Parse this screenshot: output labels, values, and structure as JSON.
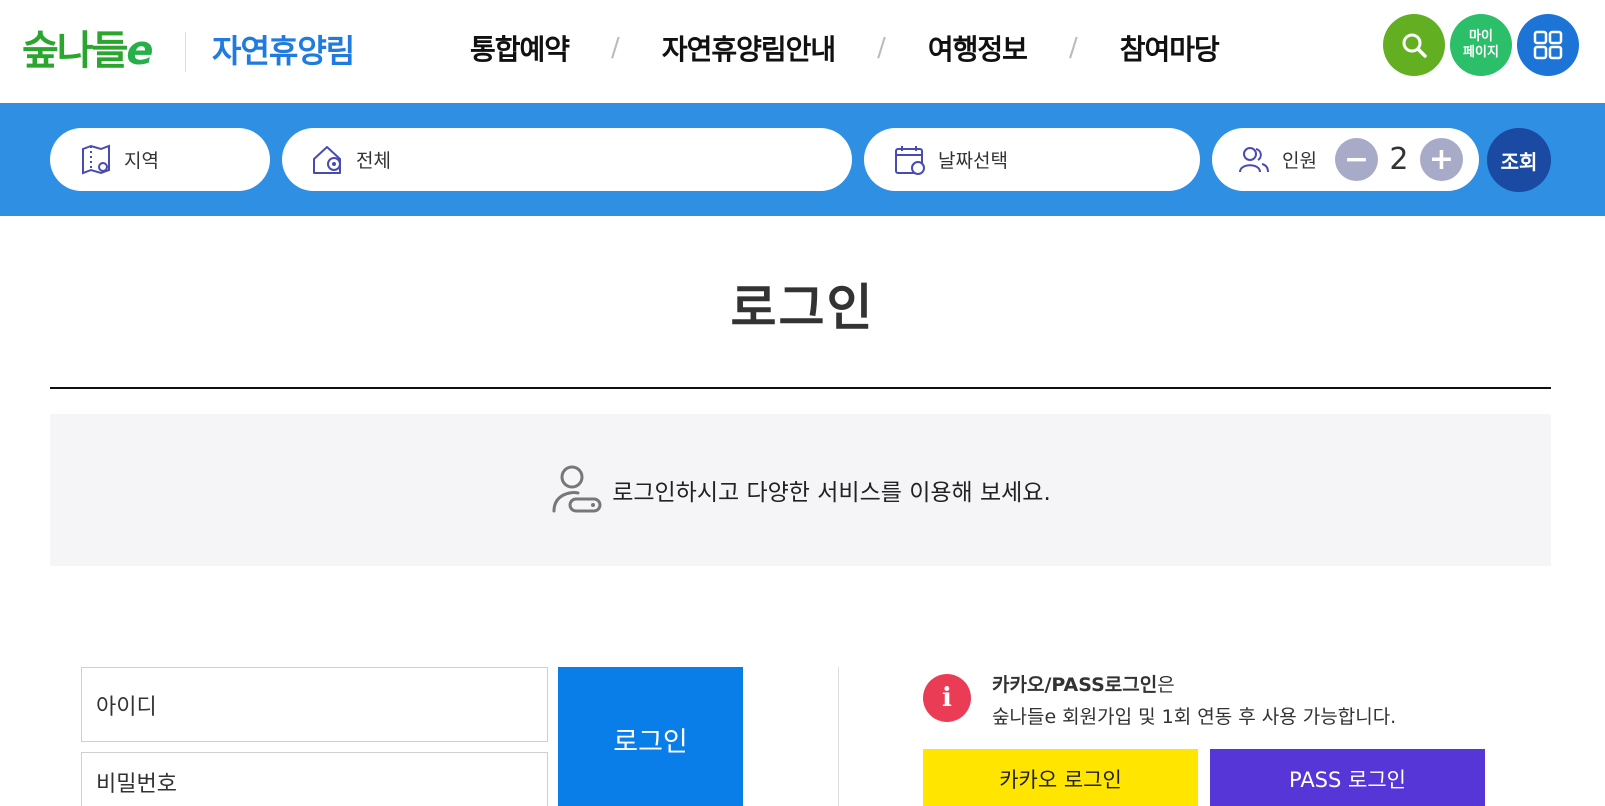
{
  "header": {
    "logo_text": "숲나들",
    "logo_e": "e",
    "site_name": "자연휴양림",
    "nav": [
      "통합예약",
      "자연휴양림안내",
      "여행정보",
      "참여마당"
    ],
    "nav_separator": "/",
    "mypage_line1": "마이",
    "mypage_line2": "페이지"
  },
  "search": {
    "region_label": "지역",
    "facility_label": "전체",
    "date_label": "날짜선택",
    "people_label": "인원",
    "people_count": "2",
    "minus": "−",
    "plus": "+",
    "query_button": "조회"
  },
  "main": {
    "title": "로그인",
    "info_message": "로그인하시고 다양한 서비스를 이용해 보세요."
  },
  "login": {
    "id_placeholder": "아이디",
    "pw_placeholder": "비밀번호",
    "submit_label": "로그인",
    "notice_icon_text": "i",
    "notice_bold": "카카오/PASS로그인",
    "notice_suffix": "은",
    "notice_line2": "숲나들e 회원가입 및 1회 연동 후 사용 가능합니다.",
    "kakao_label": "카카오 로그인",
    "pass_label": "PASS 로그인"
  },
  "colors": {
    "brand_blue": "#2f8fe3",
    "logo_green": "#2aa52e",
    "login_button": "#0a7ee8",
    "kakao": "#ffe500",
    "pass": "#5636d6",
    "notice_red": "#ea3d55"
  }
}
